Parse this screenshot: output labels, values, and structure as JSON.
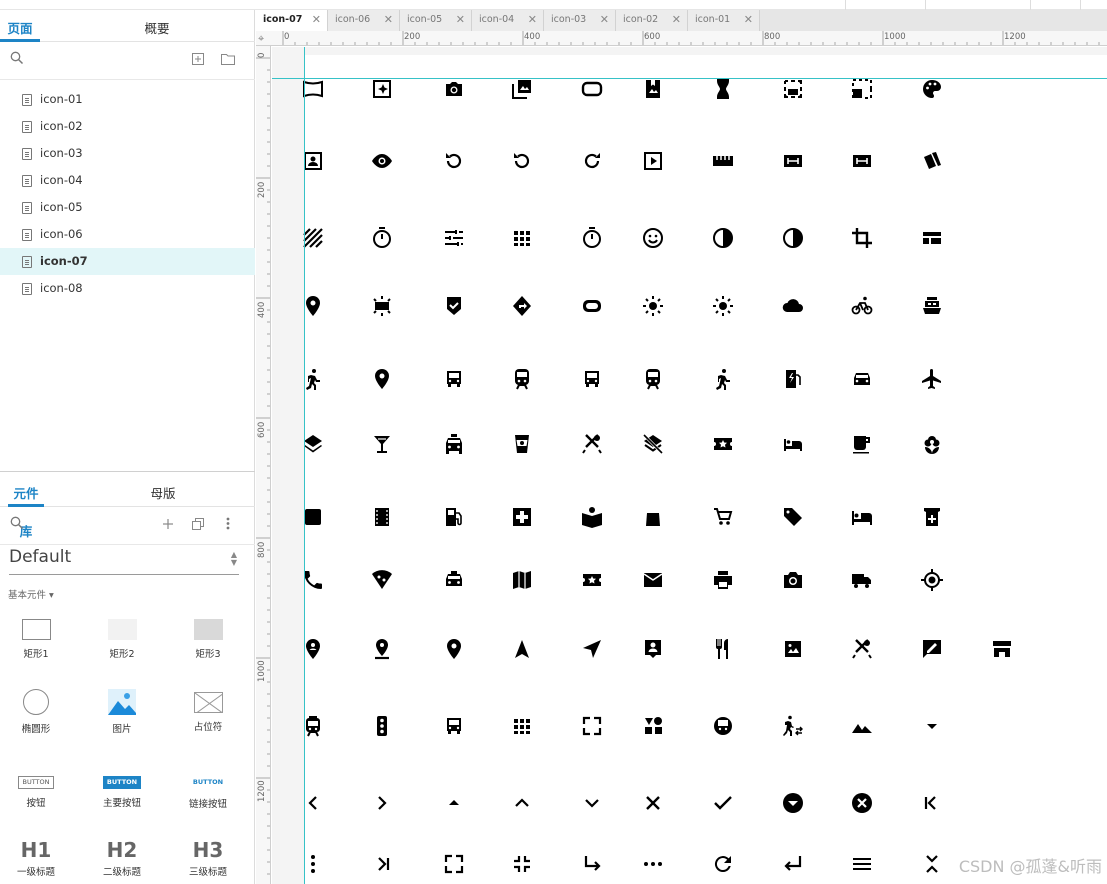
{
  "left_panel": {
    "tabs": [
      {
        "label": "页面"
      },
      {
        "label": "概要"
      }
    ],
    "pages": [
      "icon-01",
      "icon-02",
      "icon-03",
      "icon-04",
      "icon-05",
      "icon-06",
      "icon-07",
      "icon-08"
    ],
    "selected_page": "icon-07",
    "library_tabs": [
      {
        "label": "元件库"
      },
      {
        "label": "母版"
      }
    ],
    "library_name": "Default",
    "category": "基本元件 ▾",
    "widgets": [
      {
        "label": "矩形1",
        "kind": "rect1"
      },
      {
        "label": "矩形2",
        "kind": "rect2"
      },
      {
        "label": "矩形3",
        "kind": "rect3"
      },
      {
        "label": "椭圆形",
        "kind": "ellipse"
      },
      {
        "label": "图片",
        "kind": "image"
      },
      {
        "label": "占位符",
        "kind": "placeholder"
      },
      {
        "label": "按钮",
        "kind": "button",
        "text": "BUTTON"
      },
      {
        "label": "主要按钮",
        "kind": "primary-button",
        "text": "BUTTON"
      },
      {
        "label": "链接按钮",
        "kind": "link-button",
        "text": "BUTTON"
      },
      {
        "label": "一级标题",
        "kind": "heading",
        "text": "H1"
      },
      {
        "label": "二级标题",
        "kind": "heading",
        "text": "H2"
      },
      {
        "label": "三级标题",
        "kind": "heading",
        "text": "H3"
      }
    ]
  },
  "file_tabs": [
    {
      "label": "icon-07",
      "active": true
    },
    {
      "label": "icon-06"
    },
    {
      "label": "icon-05"
    },
    {
      "label": "icon-04"
    },
    {
      "label": "icon-03"
    },
    {
      "label": "icon-02"
    },
    {
      "label": "icon-01"
    }
  ],
  "ruler": {
    "h_labels": [
      "0",
      "200",
      "400",
      "600",
      "800",
      "1000",
      "1200"
    ],
    "v_labels": [
      "0",
      "200",
      "400",
      "600",
      "800",
      "1000",
      "1200"
    ]
  },
  "accent_color": "#1d84c6",
  "guide_color": "#36c2c7",
  "icon_grid": [
    [
      "panorama-icon",
      "auto-awesome-icon",
      "camera-icon",
      "photo-library-icon",
      "crop-landscape-icon",
      "photo-album-icon",
      "hourglass-icon",
      "photo-size-select-icon",
      "select-all-icon",
      "palette-icon"
    ],
    [
      "portrait-icon",
      "visibility-icon",
      "rotate-90-icon",
      "rotate-left-icon",
      "rotate-right-icon",
      "slideshow-icon",
      "straighten-icon",
      "switch-camera-icon",
      "switch-video-icon",
      "style-icon"
    ],
    [
      "texture-icon",
      "timer-icon",
      "tune-icon",
      "view-comfy-icon",
      "timer-off-icon",
      "tag-faces-icon",
      "brightness-icon",
      "contrast-icon",
      "crop-icon",
      "view-quilt-icon"
    ],
    [
      "add-location-icon",
      "wb-iridescent-icon",
      "beenhere-icon",
      "directions-icon",
      "crop-16-9-icon",
      "wb-incandescent-icon",
      "wb-sunny-icon",
      "cloud-icon",
      "bike-icon",
      "boat-icon"
    ],
    [
      "walk-icon",
      "edit-location-icon",
      "bus-icon",
      "railway-icon",
      "subway-icon",
      "train-icon",
      "run-icon",
      "ev-station-icon",
      "car-icon",
      "airplane-icon"
    ],
    [
      "layers-icon",
      "bar-icon",
      "taxi-icon",
      "drink-icon",
      "dining-icon",
      "layers-clear-icon",
      "activity-icon",
      "hotel-icon",
      "cafe-icon",
      "florist-icon"
    ],
    [
      "laundry-icon",
      "movies-icon",
      "gas-station-icon",
      "hospital-icon",
      "library-icon",
      "mall-icon",
      "grocery-cart-icon",
      "offer-icon",
      "hotel-bed-icon",
      "pharmacy-icon"
    ],
    [
      "phone-icon",
      "pizza-icon",
      "cab-icon",
      "map-icon",
      "ticket-icon",
      "post-office-icon",
      "printshop-icon",
      "camera-alt-icon",
      "shipping-icon",
      "my-location-icon"
    ],
    [
      "person-pin-circle-icon",
      "pin-drop-icon",
      "place-icon",
      "navigation-icon",
      "near-me-icon",
      "person-pin-icon",
      "restaurant-icon",
      "terrain-icon",
      "restaurant-menu-icon",
      "rate-review-icon",
      "store-icon"
    ],
    [
      "tram-icon",
      "traffic-icon",
      "directions-transit-icon",
      "apps-icon",
      "zoom-out-map-icon",
      "category-icon",
      "subway-alt-icon",
      "transfer-icon",
      "landscape-icon",
      "arrow-drop-down-icon"
    ],
    [
      "chevron-left-icon",
      "chevron-right-icon",
      "arrow-drop-up-icon",
      "expand-less-icon",
      "expand-more-icon",
      "close-icon",
      "check-icon",
      "arrow-drop-down-circle-icon",
      "cancel-icon",
      "first-page-icon"
    ],
    [
      "more-vert-icon",
      "last-page-icon",
      "fullscreen-icon",
      "fullscreen-exit-icon",
      "subdirectory-arrow-right-icon",
      "more-horiz-icon",
      "refresh-icon",
      "subdirectory-arrow-left-icon",
      "menu-icon",
      "unfold-less-icon"
    ]
  ],
  "watermark": "CSDN @孤蓬&听雨"
}
